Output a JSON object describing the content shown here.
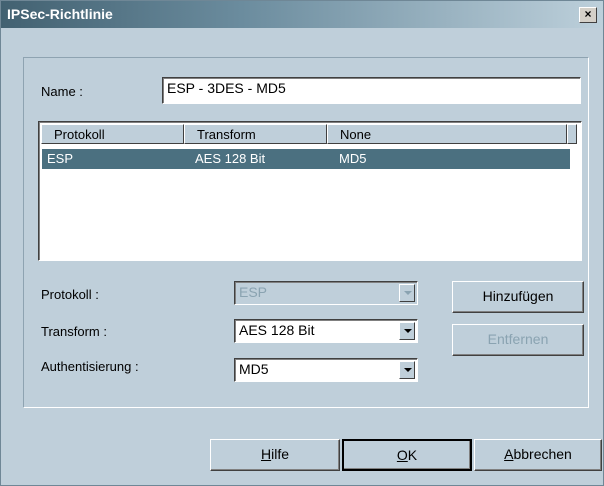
{
  "window": {
    "title": "IPSec-Richtlinie",
    "close_glyph": "×"
  },
  "name_label": "Name :",
  "name_value": "ESP - 3DES - MD5",
  "table": {
    "columns": [
      "Protokoll",
      "Transform",
      "None"
    ],
    "rows": [
      {
        "protokoll": "ESP",
        "transform": "AES 128 Bit",
        "none": "MD5"
      }
    ]
  },
  "protokoll": {
    "label": "Protokoll :",
    "value": "ESP"
  },
  "transform": {
    "label": "Transform :",
    "value": "AES 128 Bit"
  },
  "auth": {
    "label": "Authentisierung :",
    "value": "MD5"
  },
  "buttons": {
    "add": "Hinzufügen",
    "remove": "Entfernen",
    "help_first": "H",
    "help_rest": "ilfe",
    "ok_first": "O",
    "ok_rest": "K",
    "cancel_first": "A",
    "cancel_rest": "bbrechen"
  }
}
